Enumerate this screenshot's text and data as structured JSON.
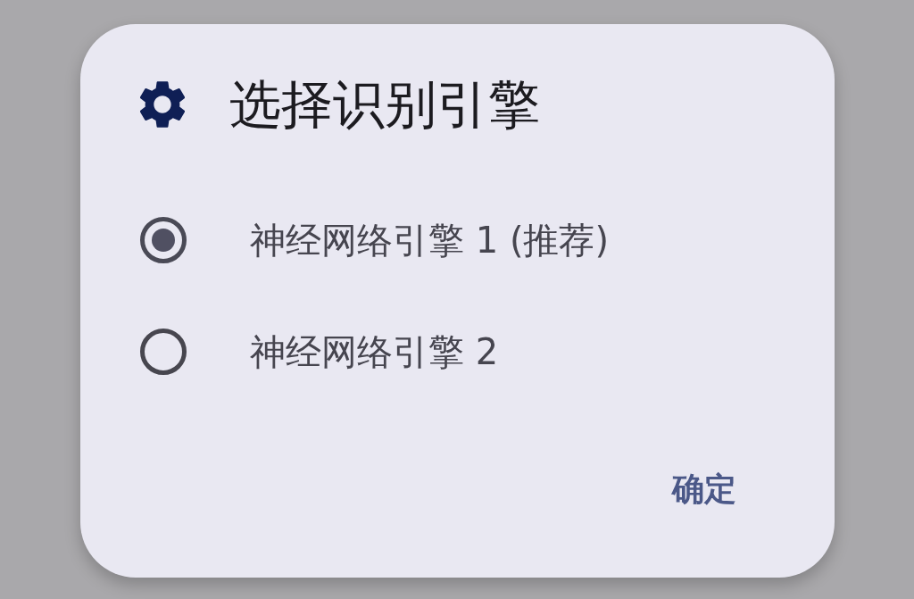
{
  "dialog": {
    "title": "选择识别引擎",
    "options": [
      {
        "label": "神经网络引擎 1 (推荐)",
        "selected": true
      },
      {
        "label": "神经网络引擎 2",
        "selected": false
      }
    ],
    "buttons": [
      "确定"
    ]
  }
}
